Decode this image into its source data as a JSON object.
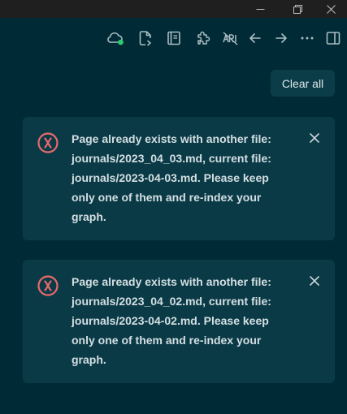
{
  "titlebar": {
    "minimize_icon": "minimize-icon",
    "restore_icon": "restore-icon",
    "close_icon": "close-icon"
  },
  "toolbar": {
    "icons": [
      "cloud-sync-icon",
      "file-sync-icon",
      "journal-icon",
      "plugins-icon",
      "tts-off-icon",
      "arrow-left-icon",
      "arrow-right-icon",
      "more-icon",
      "sidebar-toggle-icon"
    ],
    "sync_status_color": "#2ecc71"
  },
  "notifications": {
    "clear_all_label": "Clear all",
    "items": [
      {
        "type": "error",
        "lines": [
          "Page already exists with another file:",
          "journals/2023_04_03.md, current file:",
          "journals/2023-04-03.md. Please keep",
          "only one of them and re-index your",
          "graph."
        ]
      },
      {
        "type": "error",
        "lines": [
          "Page already exists with another file:",
          "journals/2023_04_02.md, current file:",
          "journals/2023-04-02.md. Please keep",
          "only one of them and re-index your",
          "graph."
        ]
      }
    ]
  },
  "colors": {
    "background": "#002b36",
    "card": "#0b3a47",
    "error": "#e86a6a",
    "text": "#d3dfe2"
  }
}
